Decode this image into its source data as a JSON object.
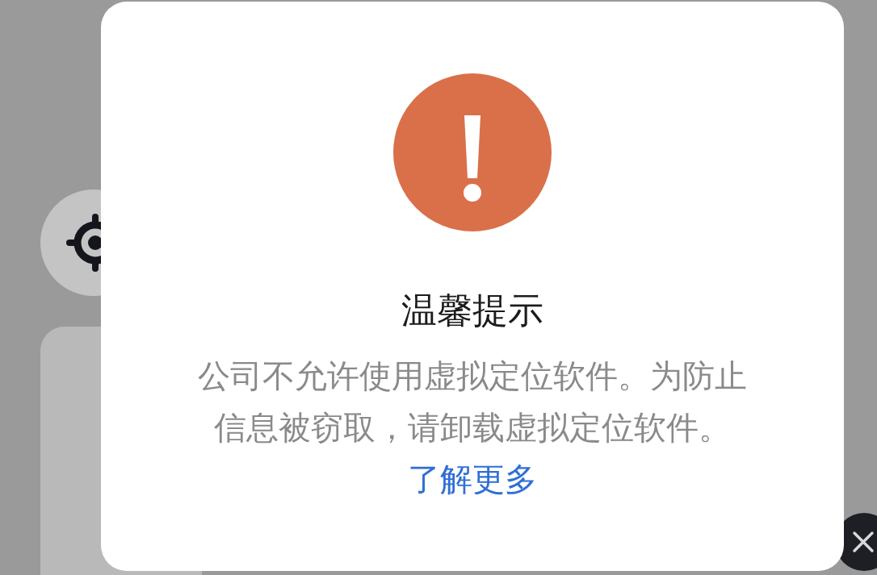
{
  "dialog": {
    "title": "温馨提示",
    "message": "公司不允许使用虚拟定位软件。为防止信息被窃取，请卸载虚拟定位软件。",
    "link": "了解更多"
  }
}
